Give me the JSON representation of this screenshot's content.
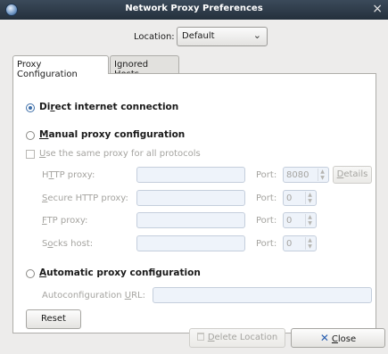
{
  "window": {
    "title": "Network Proxy Preferences",
    "close_glyph": "×"
  },
  "location": {
    "label": "Location:",
    "selected": "Default"
  },
  "tabs": [
    {
      "label": "Proxy Configuration",
      "active": true
    },
    {
      "label": "Ignored Hosts",
      "active": false
    }
  ],
  "direct": {
    "label_pre": "Di",
    "label_mn": "r",
    "label_post": "ect internet connection",
    "selected": true
  },
  "manual": {
    "label_mn": "M",
    "label_post": "anual proxy configuration",
    "selected": false
  },
  "same_proxy": {
    "label_mn": "U",
    "label_post": "se the same proxy for all protocols",
    "checked": false
  },
  "proxies": [
    {
      "label_pre": "H",
      "label_mn": "T",
      "label_post": "TP proxy:",
      "host": "",
      "port_label": "Port:",
      "port": "8080"
    },
    {
      "label_pre": "",
      "label_mn": "S",
      "label_post": "ecure HTTP proxy:",
      "host": "",
      "port_label": "Port:",
      "port": "0"
    },
    {
      "label_pre": "",
      "label_mn": "F",
      "label_post": "TP proxy:",
      "host": "",
      "port_label": "Port:",
      "port": "0"
    },
    {
      "label_pre": "S",
      "label_mn": "o",
      "label_post": "cks host:",
      "host": "",
      "port_label": "Port:",
      "port": "0"
    }
  ],
  "details_button": {
    "label_mn": "D",
    "label_post": "etails"
  },
  "automatic": {
    "label_mn": "A",
    "label_post": "utomatic proxy configuration",
    "selected": false
  },
  "autoconfig": {
    "label_pre": "Autoconfiguration ",
    "label_mn": "U",
    "label_post": "RL:",
    "value": ""
  },
  "reset_button": {
    "label": "Reset"
  },
  "delete_button": {
    "label_mn": "D",
    "label_post": "elete Location"
  },
  "close_button": {
    "label_mn": "C",
    "label_post": "lose"
  },
  "colors": {
    "titlebar": "#2e3b48",
    "accent": "#3d6ea8",
    "disabled_text": "#a5a4a0"
  }
}
